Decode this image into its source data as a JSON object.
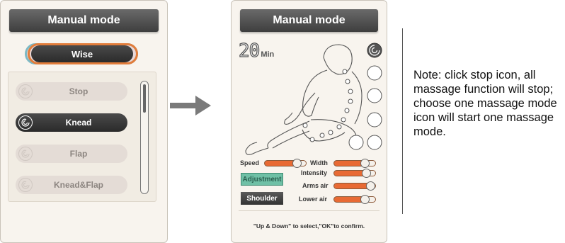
{
  "left_panel": {
    "title": "Manual mode",
    "wise_label": "Wise",
    "modes": [
      {
        "label": "Stop",
        "active": false
      },
      {
        "label": "Knead",
        "active": true
      },
      {
        "label": "Flap",
        "active": false
      },
      {
        "label": "Knead&Flap",
        "active": false
      }
    ]
  },
  "right_panel": {
    "title": "Manual mode",
    "timer_value": "20",
    "timer_unit": "Min",
    "controls": {
      "speed_label": "Speed",
      "width_label": "Width",
      "intensity_label": "Intensity",
      "arms_air_label": "Arms air",
      "lower_air_label": "Lower air",
      "adjustment_label": "Adjustment",
      "shoulder_label": "Shoulder"
    },
    "slider_levels": {
      "speed": 0.8,
      "width": 0.75,
      "intensity": 0.8,
      "arms_air": 0.9,
      "lower_air": 0.75
    },
    "hint": "\"Up & Down\" to select,\"OK\"to confirm."
  },
  "note": "Note: click stop icon, all massage function will stop; choose one massage mode icon will start one massage mode.",
  "colors": {
    "accent": "#e86a34",
    "dark_button": "#3a3a3a",
    "teal_button": "#6fc0a6"
  }
}
